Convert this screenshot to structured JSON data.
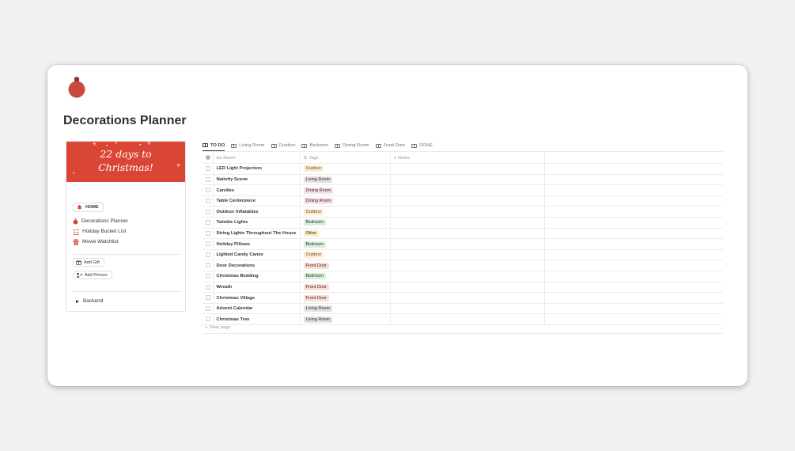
{
  "page": {
    "title": "Decorations Planner",
    "icon": "ornament-icon"
  },
  "sidebar": {
    "banner_line1": "22 days to",
    "banner_line2": "Christmas!",
    "home_label": "HOME",
    "links": [
      {
        "label": "Decorations Planner",
        "icon": "ornament-icon"
      },
      {
        "label": "Holiday Bucket List",
        "icon": "checklist-icon"
      },
      {
        "label": "Movie Watchlist",
        "icon": "gift-icon"
      }
    ],
    "add_gift_label": "Add Gift",
    "add_person_label": "Add Person",
    "backend_label": "Backend"
  },
  "tabs": [
    "TO DO",
    "Living Room",
    "Outdoor",
    "Bedroom",
    "Dining Room",
    "Front Door",
    "DONE"
  ],
  "table": {
    "headers": {
      "name_prefix": "Aa",
      "name": "Name",
      "tags": "Tags",
      "notes": "Notes"
    },
    "rows": [
      {
        "name": "LED Light Projectors",
        "tag": "Outdoor"
      },
      {
        "name": "Nativity Scene",
        "tag": "Living Room"
      },
      {
        "name": "Candles",
        "tag": "Dining Room"
      },
      {
        "name": "Table Centerpiece",
        "tag": "Dining Room"
      },
      {
        "name": "Outdoor Inflatables",
        "tag": "Outdoor"
      },
      {
        "name": "Twinkle Lights",
        "tag": "Bedroom"
      },
      {
        "name": "String Lights Throughout The House",
        "tag": "Other"
      },
      {
        "name": "Holiday Pillows",
        "tag": "Bedroom"
      },
      {
        "name": "Lighted Candy Canes",
        "tag": "Outdoor"
      },
      {
        "name": "Door Decorations",
        "tag": "Front Door"
      },
      {
        "name": "Christmas Bedding",
        "tag": "Bedroom"
      },
      {
        "name": "Wreath",
        "tag": "Front Door"
      },
      {
        "name": "Christmas Village",
        "tag": "Front Door"
      },
      {
        "name": "Advent Calendar",
        "tag": "Living Room"
      },
      {
        "name": "Christmas Tree",
        "tag": "Living Room"
      }
    ],
    "new_page_label": "New page"
  },
  "tag_colors": {
    "Outdoor": {
      "bg": "#fbedd6",
      "fg": "#6b4b16"
    },
    "Living Room": {
      "bg": "#e3e2e0",
      "fg": "#32302c"
    },
    "Dining Room": {
      "bg": "#f5e0e9",
      "fg": "#4c2337"
    },
    "Bedroom": {
      "bg": "#dbeddb",
      "fg": "#1c3829"
    },
    "Other": {
      "bg": "#fdecc8",
      "fg": "#402c1b"
    },
    "Front Door": {
      "bg": "#f5e0d9",
      "fg": "#5d1715"
    }
  },
  "colors": {
    "banner": "#da4636",
    "ornament": "#c94a3d"
  }
}
